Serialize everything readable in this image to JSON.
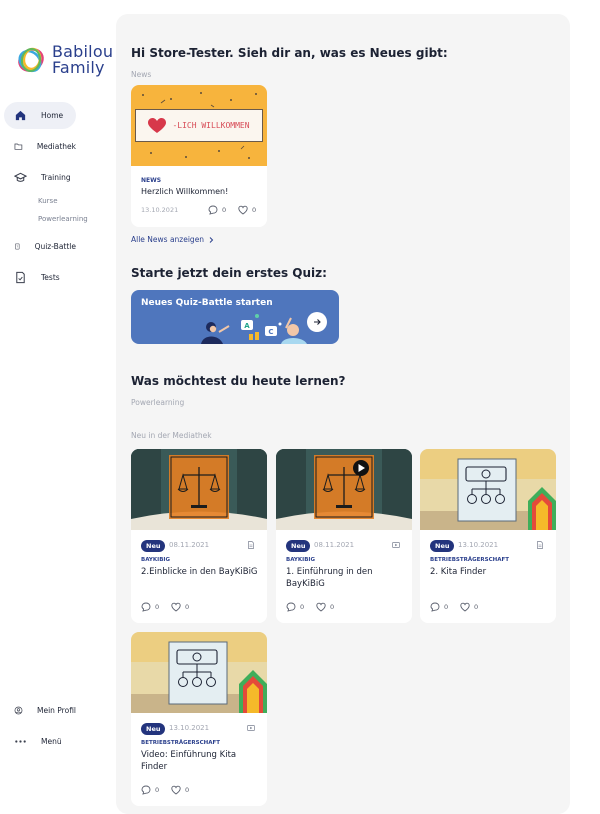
{
  "brand": {
    "line1": "Babilou",
    "line2": "Family"
  },
  "nav": {
    "home": "Home",
    "mediathek": "Mediathek",
    "training": "Training",
    "kurse": "Kurse",
    "powerlearning": "Powerlearning",
    "quiz_battle": "Quiz-Battle",
    "tests": "Tests",
    "profile": "Mein Profil",
    "menu": "Menü"
  },
  "greeting": "Hi Store-Tester. Sieh dir an, was es Neues gibt:",
  "news": {
    "section": "News",
    "banner": "-LICH WILLKOMMEN",
    "category": "NEWS",
    "title": "Herzlich Willkommen!",
    "date": "13.10.2021",
    "comments": "0",
    "likes": "0",
    "all_link": "Alle News anzeigen"
  },
  "quiz": {
    "heading": "Starte jetzt dein erstes Quiz:",
    "button": "Neues Quiz-Battle starten"
  },
  "learn": {
    "heading": "Was möchtest du heute lernen?",
    "powerlearning": "Powerlearning",
    "new_section": "Neu in der Mediathek"
  },
  "media": [
    {
      "badge": "Neu",
      "date": "08.11.2021",
      "category": "BAYKIBIG",
      "title": "2.Einblicke in den BayKiBiG",
      "comments": "0",
      "likes": "0",
      "type": "document-icon"
    },
    {
      "badge": "Neu",
      "date": "08.11.2021",
      "category": "BAYKIBIG",
      "title": "1. Einführung in den BayKiBiG",
      "comments": "0",
      "likes": "0",
      "type": "video-icon"
    },
    {
      "badge": "Neu",
      "date": "13.10.2021",
      "category": "BETRIEBSTRÄGERSCHAFT",
      "title": "2. Kita Finder",
      "comments": "0",
      "likes": "0",
      "type": "document-icon"
    },
    {
      "badge": "Neu",
      "date": "13.10.2021",
      "category": "BETRIEBSTRÄGERSCHAFT",
      "title": "Video: Einführung Kita Finder",
      "comments": "0",
      "likes": "0",
      "type": "video-icon"
    }
  ],
  "colors": {
    "accent": "#2a3f8c",
    "badge": "#23347d",
    "quiz": "#4f76bd",
    "news_bg": "#f7b43d"
  }
}
